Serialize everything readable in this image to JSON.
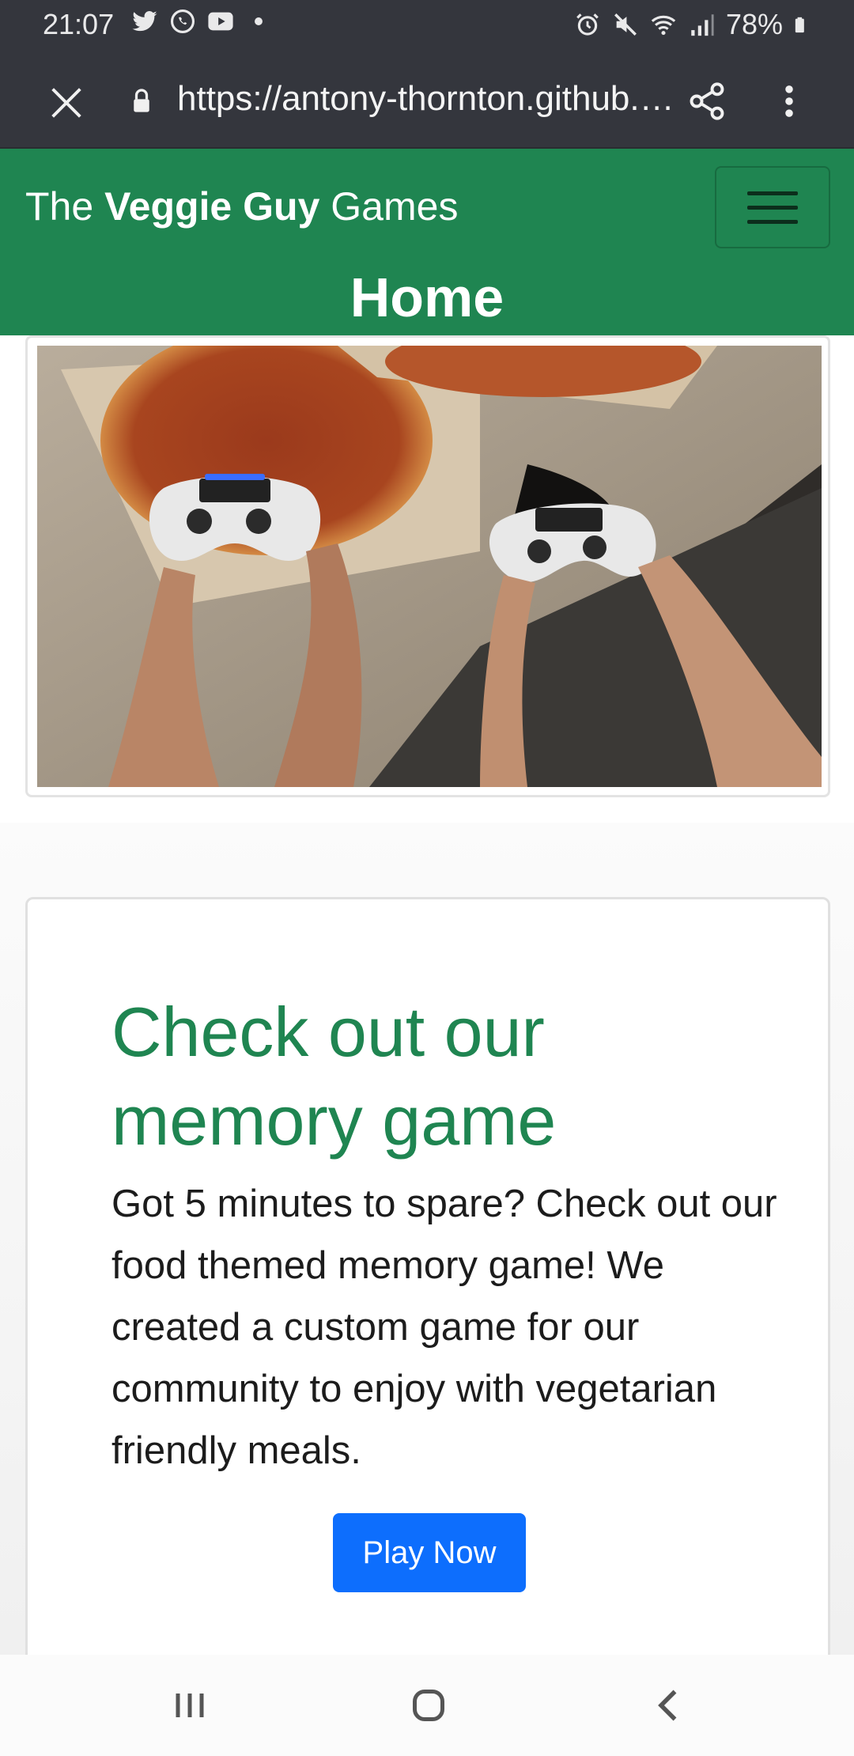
{
  "status_bar": {
    "time": "21:07",
    "battery": "78%",
    "icons": [
      "twitter-icon",
      "whatsapp-icon",
      "youtube-icon",
      "dot-icon",
      "alarm-icon",
      "mute-icon",
      "wifi-icon",
      "signal-icon",
      "battery-icon"
    ]
  },
  "browser": {
    "url": "https://antony-thornton.github.…",
    "icons": [
      "close-icon",
      "lock-icon",
      "share-icon",
      "more-vert-icon"
    ]
  },
  "navbar": {
    "brand_prefix": "The ",
    "brand_bold": "Veggie Guy",
    "brand_suffix": " Games",
    "page_heading": "Home",
    "menu_icon": "hamburger-icon"
  },
  "game_card": {
    "title": "Check out our memory game",
    "text": "Got 5 minutes to spare? Check out our food themed memory game! We created a custom game for our community to enjoy with vegetarian friendly meals.",
    "button_label": "Play Now"
  },
  "nav_bar": {
    "icons": [
      "recents-icon",
      "home-icon",
      "back-icon"
    ]
  },
  "colors": {
    "brand_green": "#1f8551",
    "button_blue": "#0d6efd",
    "system_bar": "#34363d"
  }
}
